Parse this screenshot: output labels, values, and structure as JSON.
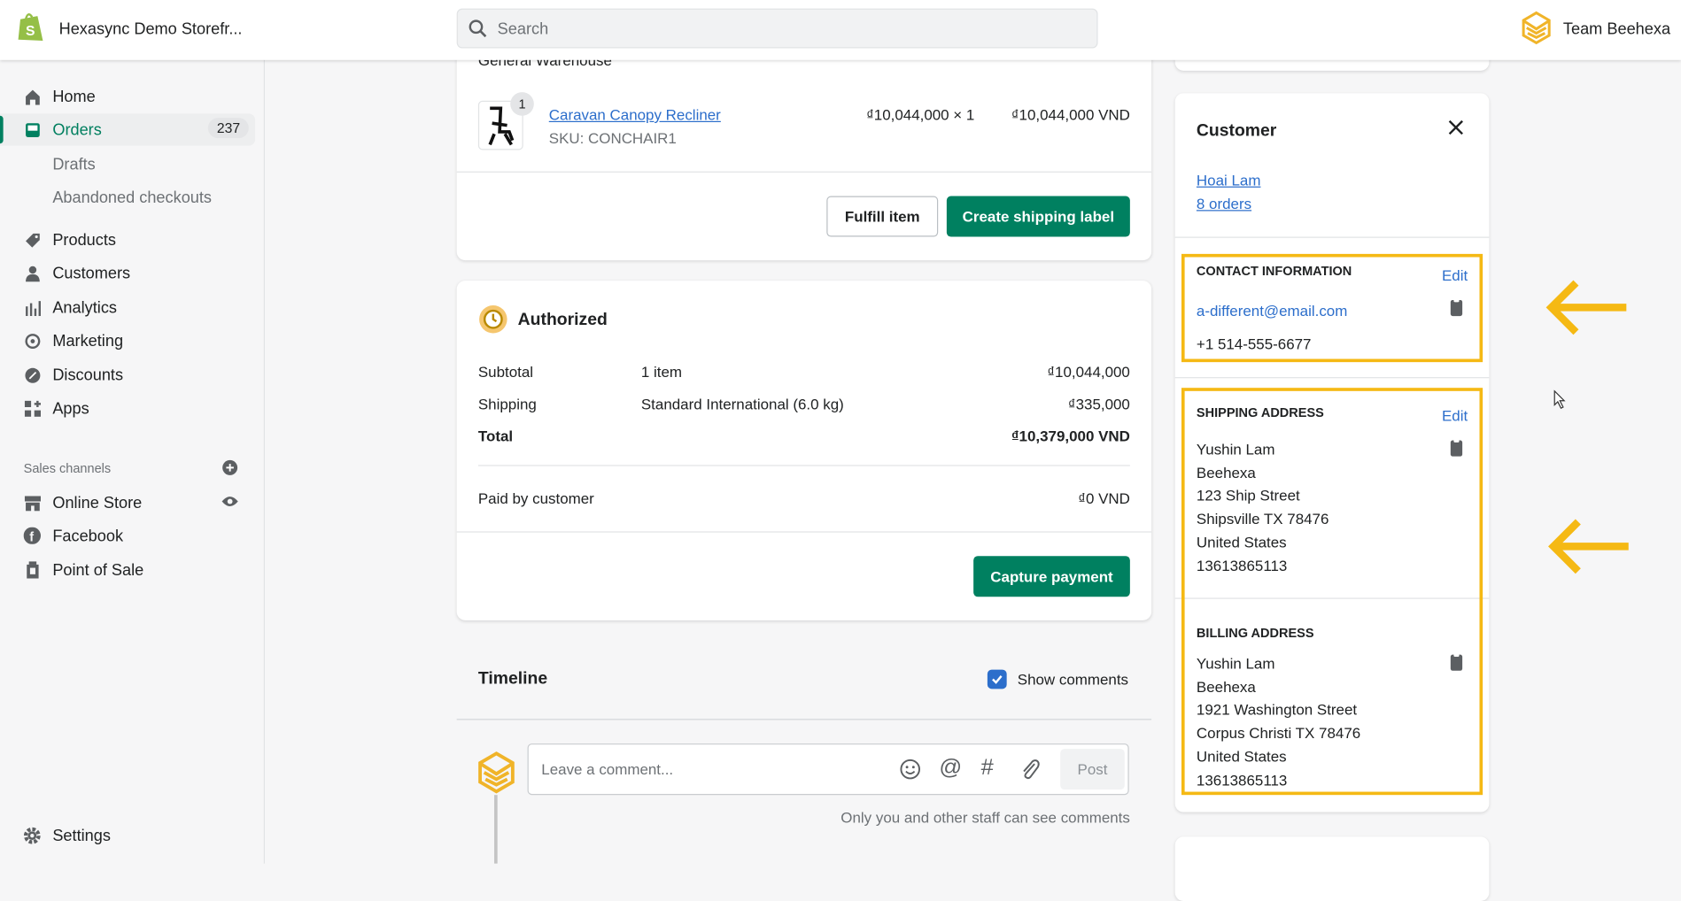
{
  "topbar": {
    "store_name": "Hexasync Demo Storefr...",
    "search_placeholder": "Search",
    "account_name": "Team Beehexa"
  },
  "sidebar": {
    "items": [
      {
        "label": "Home",
        "icon": "home-icon"
      },
      {
        "label": "Orders",
        "icon": "orders-icon",
        "badge": "237",
        "active": true
      },
      {
        "label": "Drafts"
      },
      {
        "label": "Abandoned checkouts"
      },
      {
        "label": "Products",
        "icon": "tag-icon"
      },
      {
        "label": "Customers",
        "icon": "person-icon"
      },
      {
        "label": "Analytics",
        "icon": "bar-chart-icon"
      },
      {
        "label": "Marketing",
        "icon": "target-icon"
      },
      {
        "label": "Discounts",
        "icon": "discount-icon"
      },
      {
        "label": "Apps",
        "icon": "apps-icon"
      }
    ],
    "sales_channels_label": "Sales channels",
    "channels": [
      {
        "label": "Online Store",
        "icon": "store-icon"
      },
      {
        "label": "Facebook",
        "icon": "facebook-icon"
      },
      {
        "label": "Point of Sale",
        "icon": "pos-icon"
      }
    ],
    "settings_label": "Settings"
  },
  "fulfillment": {
    "location": "General Warehouse",
    "item": {
      "name": "Caravan Canopy Recliner",
      "sku": "SKU: CONCHAIR1",
      "quantity_badge": "1",
      "unit_price": "₫10,044,000 × 1",
      "total": "₫10,044,000 VND"
    },
    "fulfill_button": "Fulfill item",
    "shipping_label_button": "Create shipping label"
  },
  "payment": {
    "status": "Authorized",
    "rows": [
      {
        "label": "Subtotal",
        "detail": "1 item",
        "amount": "₫10,044,000"
      },
      {
        "label": "Shipping",
        "detail": "Standard International (6.0 kg)",
        "amount": "₫335,000"
      },
      {
        "label": "Total",
        "detail": "",
        "amount": "₫10,379,000 VND"
      }
    ],
    "paid_label": "Paid by customer",
    "paid_amount": "₫0 VND",
    "capture_button": "Capture payment"
  },
  "timeline": {
    "title": "Timeline",
    "show_comments_label": "Show comments",
    "show_comments_checked": true,
    "comment_placeholder": "Leave a comment...",
    "post_button": "Post",
    "note": "Only you and other staff can see comments"
  },
  "customer": {
    "title": "Customer",
    "name": "Hoai Lam",
    "orders": "8 orders",
    "contact": {
      "heading": "Contact information",
      "edit": "Edit",
      "email": "a-different@email.com",
      "phone": "+1 514-555-6677"
    },
    "shipping": {
      "heading": "Shipping address",
      "edit": "Edit",
      "lines": [
        "Yushin Lam",
        "Beehexa",
        "123 Ship Street",
        "Shipsville TX 78476",
        "United States",
        "13613865113"
      ]
    },
    "billing": {
      "heading": "Billing address",
      "lines": [
        "Yushin Lam",
        "Beehexa",
        "1921 Washington Street",
        "Corpus Christi TX 78476",
        "United States",
        "13613865113"
      ]
    }
  },
  "colors": {
    "accent": "#008060",
    "link": "#2c6ecb",
    "highlight": "#f5b914",
    "brand_hex": "#f0b429"
  }
}
